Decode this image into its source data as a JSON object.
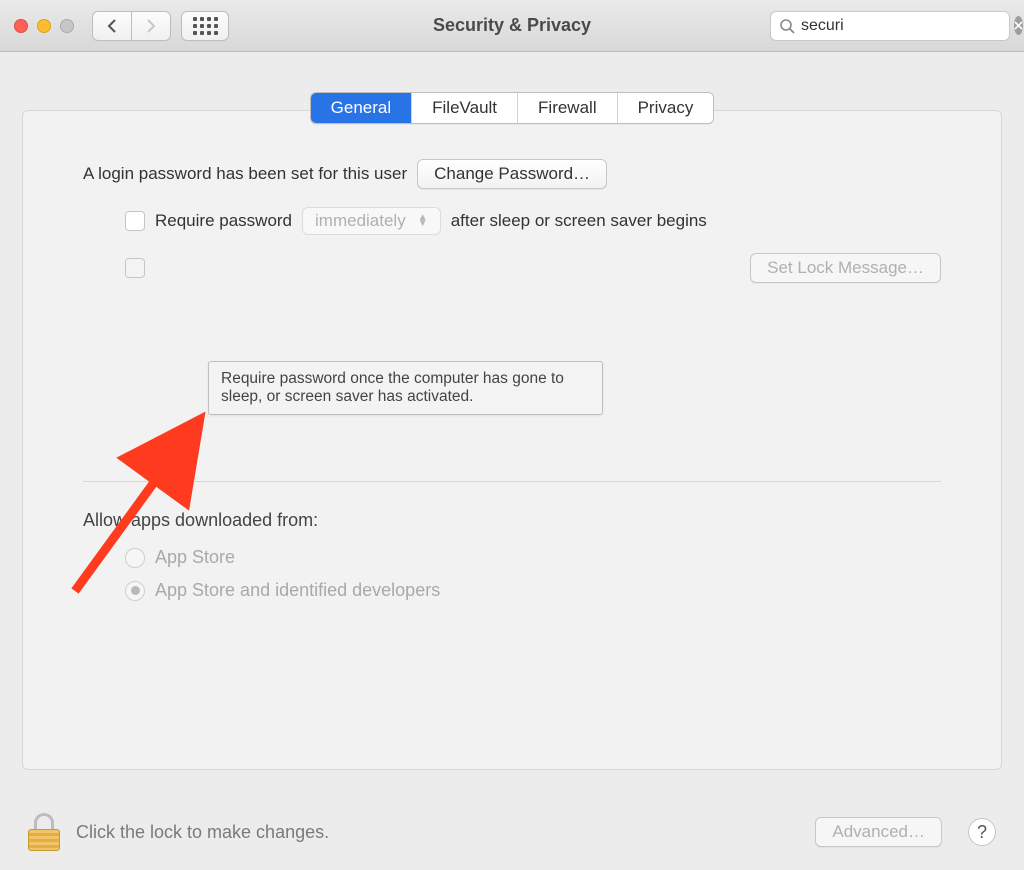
{
  "window": {
    "title": "Security & Privacy"
  },
  "search": {
    "value": "securi",
    "icon": "search-icon"
  },
  "tabs": {
    "general": "General",
    "filevault": "FileVault",
    "firewall": "Firewall",
    "privacy": "Privacy"
  },
  "main": {
    "login_set_label": "A login password has been set for this user",
    "change_password_btn": "Change Password…",
    "require_password_label": "Require password",
    "require_password_delay": "immediately",
    "after_sleep_label": "after sleep or screen saver begins",
    "set_lock_message_btn": "Set Lock Message…",
    "tooltip": "Require password once the computer has gone to sleep, or screen saver has activated.",
    "allow_apps_title": "Allow apps downloaded from:",
    "radio_app_store": "App Store",
    "radio_identified": "App Store and identified developers"
  },
  "footer": {
    "lock_text": "Click the lock to make changes.",
    "advanced_btn": "Advanced…",
    "help": "?"
  }
}
